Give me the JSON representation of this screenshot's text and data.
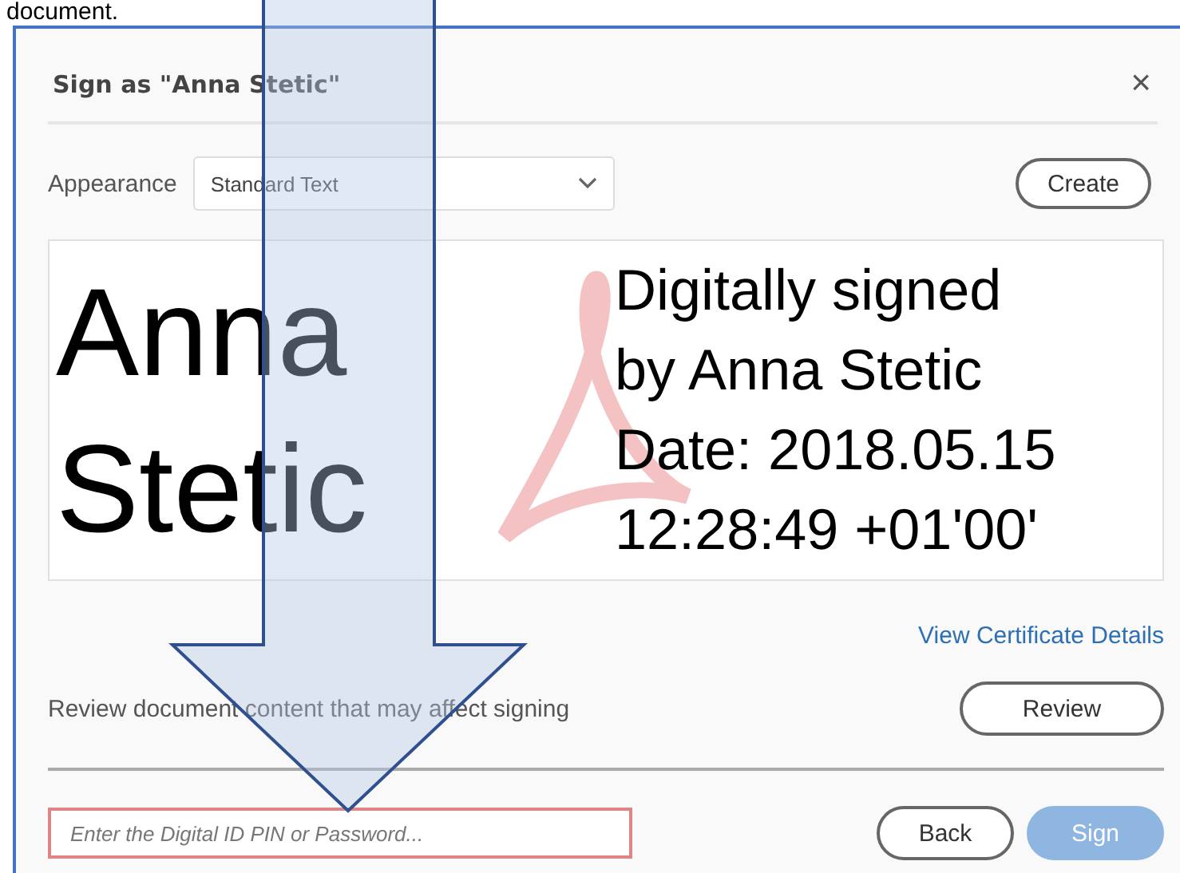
{
  "page_text": "document.",
  "dialog": {
    "title": "Sign as \"Anna Stetic\"",
    "close": "×",
    "appearance": {
      "label": "Appearance",
      "value": "Standard Text"
    },
    "create_button": "Create",
    "preview": {
      "name_lines": [
        "Anna",
        "Stetic"
      ],
      "detail_lines": [
        "Digitally signed",
        "by Anna Stetic",
        "Date: 2018.05.15",
        "12:28:49 +01'00'"
      ]
    },
    "certificate_link": "View Certificate Details",
    "review": {
      "text": "Review document content that may affect signing",
      "button": "Review"
    },
    "pin_field": {
      "placeholder": "Enter the Digital ID PIN or Password...",
      "error": true
    },
    "buttons": [
      {
        "label": "Back",
        "kind": "secondary",
        "disabled": false
      },
      {
        "label": "Sign",
        "kind": "primary",
        "disabled": true
      }
    ]
  }
}
